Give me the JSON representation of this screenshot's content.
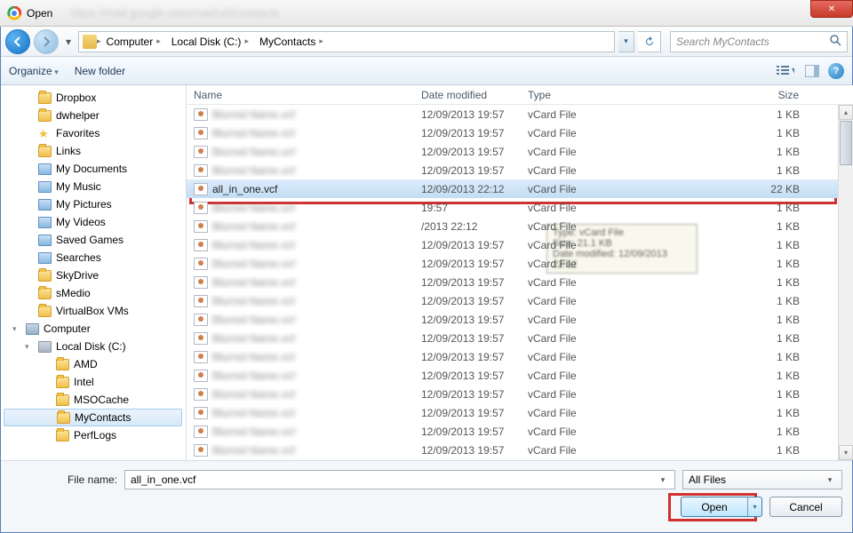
{
  "window": {
    "title": "Open"
  },
  "nav": {
    "crumbs": [
      "Computer",
      "Local Disk (C:)",
      "MyContacts"
    ],
    "search_placeholder": "Search MyContacts"
  },
  "toolbar": {
    "organize": "Organize",
    "newfolder": "New folder"
  },
  "sidebar": [
    {
      "label": "Dropbox",
      "level": 1,
      "icon": "folder"
    },
    {
      "label": "dwhelper",
      "level": 1,
      "icon": "folder"
    },
    {
      "label": "Favorites",
      "level": 1,
      "icon": "star"
    },
    {
      "label": "Links",
      "level": 1,
      "icon": "folder"
    },
    {
      "label": "My Documents",
      "level": 1,
      "icon": "special"
    },
    {
      "label": "My Music",
      "level": 1,
      "icon": "special"
    },
    {
      "label": "My Pictures",
      "level": 1,
      "icon": "special"
    },
    {
      "label": "My Videos",
      "level": 1,
      "icon": "special"
    },
    {
      "label": "Saved Games",
      "level": 1,
      "icon": "special"
    },
    {
      "label": "Searches",
      "level": 1,
      "icon": "special"
    },
    {
      "label": "SkyDrive",
      "level": 1,
      "icon": "folder"
    },
    {
      "label": "sMedio",
      "level": 1,
      "icon": "folder"
    },
    {
      "label": "VirtualBox VMs",
      "level": 1,
      "icon": "folder"
    },
    {
      "label": "Computer",
      "level": 0,
      "icon": "comp",
      "expanded": true
    },
    {
      "label": "Local Disk (C:)",
      "level": 1,
      "icon": "drive",
      "expanded": true
    },
    {
      "label": "AMD",
      "level": 2,
      "icon": "folder"
    },
    {
      "label": "Intel",
      "level": 2,
      "icon": "folder"
    },
    {
      "label": "MSOCache",
      "level": 2,
      "icon": "folder"
    },
    {
      "label": "MyContacts",
      "level": 2,
      "icon": "folder",
      "selected": true
    },
    {
      "label": "PerfLogs",
      "level": 2,
      "icon": "folder"
    }
  ],
  "columns": {
    "name": "Name",
    "date": "Date modified",
    "type": "Type",
    "size": "Size"
  },
  "files": [
    {
      "name": "—",
      "date": "12/09/2013 19:57",
      "type": "vCard File",
      "size": "1 KB",
      "blur": true
    },
    {
      "name": "—",
      "date": "12/09/2013 19:57",
      "type": "vCard File",
      "size": "1 KB",
      "blur": true
    },
    {
      "name": "—",
      "date": "12/09/2013 19:57",
      "type": "vCard File",
      "size": "1 KB",
      "blur": true
    },
    {
      "name": "—",
      "date": "12/09/2013 19:57",
      "type": "vCard File",
      "size": "1 KB",
      "blur": true
    },
    {
      "name": "all_in_one.vcf",
      "date": "12/09/2013 22:12",
      "type": "vCard File",
      "size": "22 KB",
      "blur": false,
      "selected": true
    },
    {
      "name": "—",
      "date": "19:57",
      "type": "vCard File",
      "size": "1 KB",
      "blur": true
    },
    {
      "name": "—",
      "date": "/2013 22:12",
      "type": "vCard File",
      "size": "1 KB",
      "blur": true
    },
    {
      "name": "—",
      "date": "12/09/2013 19:57",
      "type": "vCard File",
      "size": "1 KB",
      "blur": true
    },
    {
      "name": "—",
      "date": "12/09/2013 19:57",
      "type": "vCard File",
      "size": "1 KB",
      "blur": true
    },
    {
      "name": "—",
      "date": "12/09/2013 19:57",
      "type": "vCard File",
      "size": "1 KB",
      "blur": true
    },
    {
      "name": "—",
      "date": "12/09/2013 19:57",
      "type": "vCard File",
      "size": "1 KB",
      "blur": true
    },
    {
      "name": "—",
      "date": "12/09/2013 19:57",
      "type": "vCard File",
      "size": "1 KB",
      "blur": true
    },
    {
      "name": "—",
      "date": "12/09/2013 19:57",
      "type": "vCard File",
      "size": "1 KB",
      "blur": true
    },
    {
      "name": "—",
      "date": "12/09/2013 19:57",
      "type": "vCard File",
      "size": "1 KB",
      "blur": true
    },
    {
      "name": "—",
      "date": "12/09/2013 19:57",
      "type": "vCard File",
      "size": "1 KB",
      "blur": true
    },
    {
      "name": "—",
      "date": "12/09/2013 19:57",
      "type": "vCard File",
      "size": "1 KB",
      "blur": true
    },
    {
      "name": "—",
      "date": "12/09/2013 19:57",
      "type": "vCard File",
      "size": "1 KB",
      "blur": true
    },
    {
      "name": "—",
      "date": "12/09/2013 19:57",
      "type": "vCard File",
      "size": "1 KB",
      "blur": true
    },
    {
      "name": "—",
      "date": "12/09/2013 19:57",
      "type": "vCard File",
      "size": "1 KB",
      "blur": true
    }
  ],
  "bottom": {
    "filename_label": "File name:",
    "filename_value": "all_in_one.vcf",
    "filter": "All Files",
    "open": "Open",
    "cancel": "Cancel"
  }
}
